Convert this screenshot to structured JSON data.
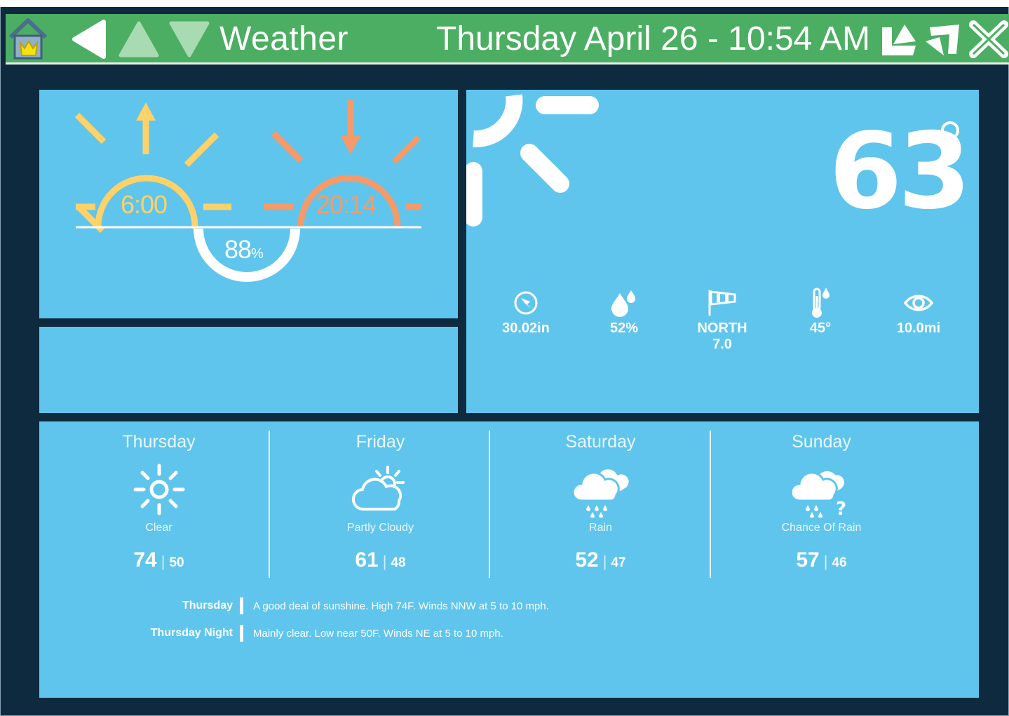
{
  "header": {
    "title": "Weather",
    "datetime": "Thursday April 26 - 10:54 AM"
  },
  "sun": {
    "sunrise": "6:00",
    "sunset": "20:14",
    "humidity_value": "88",
    "humidity_unit": "%"
  },
  "current": {
    "temperature": "63",
    "stats": [
      {
        "icon": "compass-icon",
        "value": "30.02in"
      },
      {
        "icon": "drops-icon",
        "value": "52%"
      },
      {
        "icon": "windsock-icon",
        "value": "NORTH",
        "value2": "7.0"
      },
      {
        "icon": "thermometer-dew-icon",
        "value": "45°"
      },
      {
        "icon": "eye-icon",
        "value": "10.0mi"
      }
    ]
  },
  "forecast": [
    {
      "day": "Thursday",
      "icon": "sun-icon",
      "condition": "Clear",
      "high": "74",
      "low": "50"
    },
    {
      "day": "Friday",
      "icon": "partly-cloudy-icon",
      "condition": "Partly Cloudy",
      "high": "61",
      "low": "48"
    },
    {
      "day": "Saturday",
      "icon": "rain-icon",
      "condition": "Rain",
      "high": "52",
      "low": "47"
    },
    {
      "day": "Sunday",
      "icon": "chance-rain-icon",
      "condition": "Chance Of Rain",
      "high": "57",
      "low": "46"
    }
  ],
  "narrative": [
    {
      "label": "Thursday",
      "text": "A good deal of sunshine. High 74F. Winds NNW at 5 to 10 mph."
    },
    {
      "label": "Thursday Night",
      "text": "Mainly clear. Low near 50F. Winds NE at 5 to 10 mph."
    }
  ],
  "colors": {
    "header": "#4cae62",
    "background": "#0d2a3f",
    "panel": "#5fc5ec",
    "sunrise": "#fdd26a",
    "sunset": "#f69a6a"
  }
}
